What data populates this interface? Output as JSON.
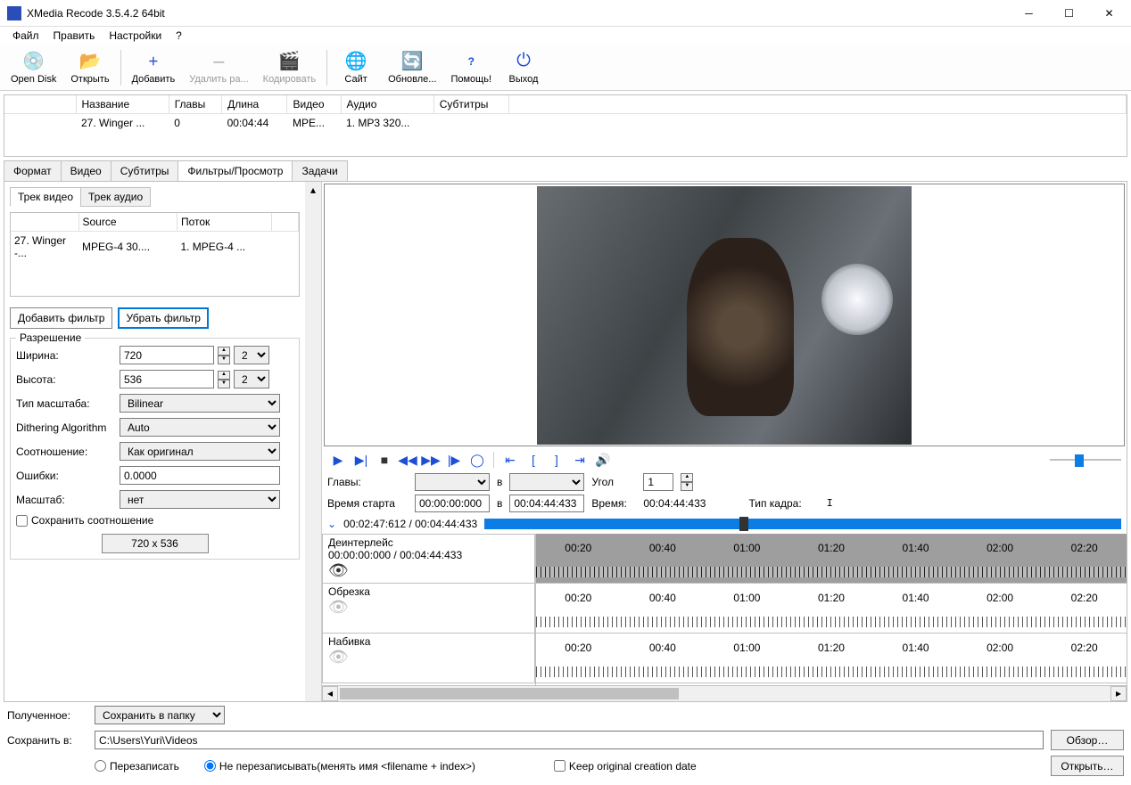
{
  "title": "XMedia Recode 3.5.4.2 64bit",
  "menu": {
    "file": "Файл",
    "edit": "Править",
    "settings": "Настройки",
    "help": "?"
  },
  "toolbar": {
    "opendisk": "Open Disk",
    "open": "Открыть",
    "add": "Добавить",
    "remove": "Удалить ра...",
    "encode": "Кодировать",
    "site": "Сайт",
    "update": "Обновле...",
    "help": "Помощь!",
    "exit": "Выход"
  },
  "filelist": {
    "cols": {
      "name": "Название",
      "chapters": "Главы",
      "length": "Длина",
      "video": "Видео",
      "audio": "Аудио",
      "subs": "Субтитры"
    },
    "row": {
      "name": "27. Winger ...",
      "chapters": "0",
      "length": "00:04:44",
      "video": "MPE...",
      "audio": "1. MP3 320...",
      "subs": ""
    }
  },
  "maintabs": {
    "format": "Формат",
    "video": "Видео",
    "subs": "Субтитры",
    "filters": "Фильтры/Просмотр",
    "tasks": "Задачи"
  },
  "subtabs": {
    "videotrack": "Трек видео",
    "audiotrack": "Трек аудио"
  },
  "tracklist": {
    "cols": {
      "name": "",
      "source": "Source",
      "stream": "Поток"
    },
    "row": {
      "name": "27. Winger -...",
      "source": "MPEG-4 30....",
      "stream": "1. MPEG-4 ..."
    }
  },
  "filterbtns": {
    "add": "Добавить фильтр",
    "remove": "Убрать фильтр"
  },
  "resolution": {
    "legend": "Разрешение",
    "width_l": "Ширина:",
    "width_v": "720",
    "width_s": "2",
    "height_l": "Высота:",
    "height_v": "536",
    "height_s": "2",
    "scaletype_l": "Тип масштаба:",
    "scaletype_v": "Bilinear",
    "dither_l": "Dithering Algorithm",
    "dither_v": "Auto",
    "ratio_l": "Соотношение:",
    "ratio_v": "Как оригинал",
    "errors_l": "Ошибки:",
    "errors_v": "0.0000",
    "scale_l": "Масштаб:",
    "scale_v": "нет",
    "keep_l": "Сохранить соотношение",
    "dims": "720 x 536"
  },
  "playback": {
    "chapters_l": "Главы:",
    "in_l": "в",
    "angle_l": "Угол",
    "angle_v": "1",
    "start_l": "Время старта",
    "start_v": "00:00:00:000",
    "end_v": "00:04:44:433",
    "time_l": "Время:",
    "time_v": "00:04:44:433",
    "frametype_l": "Тип кадра:",
    "frametype_v": "I",
    "pos": "00:02:47:612 / 00:04:44:433"
  },
  "timeline": {
    "deint": "Деинтерлейс",
    "deint_t": "00:00:00:000 / 00:04:44:433",
    "crop": "Обрезка",
    "pad": "Набивка",
    "ticks": [
      "00:20",
      "00:40",
      "01:00",
      "01:20",
      "01:40",
      "02:00",
      "02:20"
    ]
  },
  "bottom": {
    "received_l": "Полученное:",
    "received_v": "Сохранить в папку",
    "saveto_l": "Сохранить в:",
    "saveto_v": "C:\\Users\\Yuri\\Videos",
    "browse": "Обзор…",
    "openbtn": "Открыть…",
    "overwrite": "Перезаписать",
    "dontoverwrite": "Не перезаписывать(менять имя <filename + index>)",
    "keepdate": "Keep original creation date"
  }
}
